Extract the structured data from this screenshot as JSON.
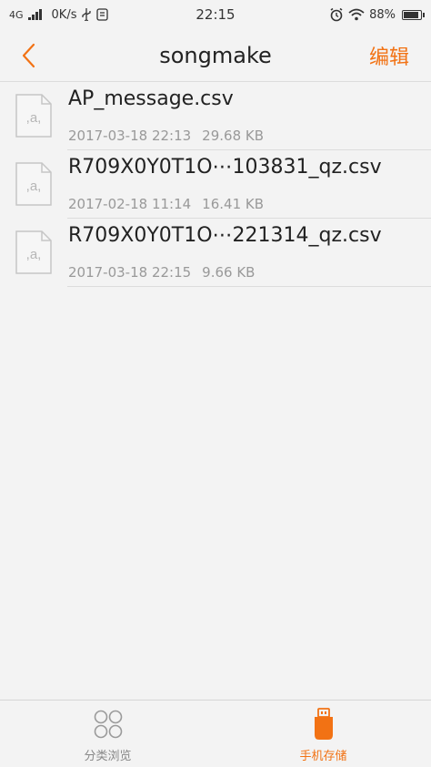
{
  "status_bar": {
    "network": "4G",
    "speed": "0K/s",
    "time": "22:15",
    "battery": "88%",
    "battery_level": 0.88
  },
  "header": {
    "title": "songmake",
    "edit_label": "编辑",
    "back_icon": "chevron-left-icon"
  },
  "files": [
    {
      "name": "AP_message.csv",
      "date": "2017-03-18 22:13",
      "size": "29.68 KB"
    },
    {
      "name": "R709X0Y0T1O⋯103831_qz.csv",
      "date": "2017-02-18 11:14",
      "size": "16.41 KB"
    },
    {
      "name": "R709X0Y0T1O⋯221314_qz.csv",
      "date": "2017-03-18 22:15",
      "size": "9.66 KB"
    }
  ],
  "bottom_nav": {
    "categories_label": "分类浏览",
    "storage_label": "手机存储",
    "active": "storage"
  },
  "colors": {
    "accent": "#f27214",
    "background": "#f3f3f3",
    "divider": "#dcdcdc"
  }
}
